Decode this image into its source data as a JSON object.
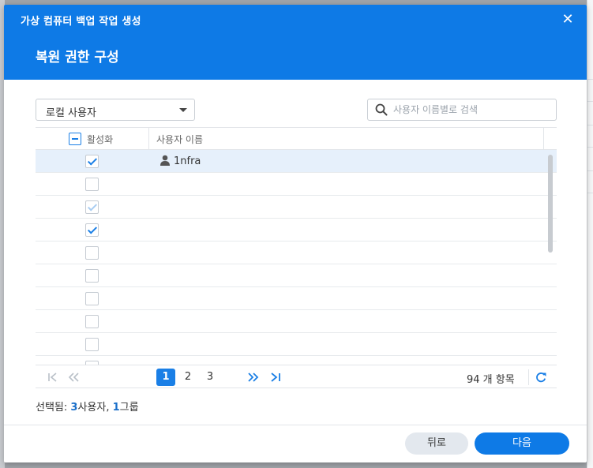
{
  "window": {
    "title": "가상 컴퓨터 백업 작업 생성",
    "close_glyph": "✕"
  },
  "step": {
    "title": "복원 권한 구성"
  },
  "filter": {
    "selected": "로컬 사용자"
  },
  "search": {
    "placeholder": "사용자 이름별로 검색",
    "value": ""
  },
  "grid": {
    "columns": {
      "enable": "활성화",
      "user_name": "사용자 이름"
    },
    "rows": [
      {
        "checked": true,
        "state": "on",
        "selected": true,
        "name": "1nfra"
      },
      {
        "checked": false,
        "state": "off",
        "selected": false,
        "name": ""
      },
      {
        "checked": true,
        "state": "dim",
        "selected": false,
        "name": ""
      },
      {
        "checked": true,
        "state": "on",
        "selected": false,
        "name": ""
      },
      {
        "checked": false,
        "state": "off",
        "selected": false,
        "name": ""
      },
      {
        "checked": false,
        "state": "off",
        "selected": false,
        "name": ""
      },
      {
        "checked": false,
        "state": "off",
        "selected": false,
        "name": ""
      },
      {
        "checked": false,
        "state": "off",
        "selected": false,
        "name": ""
      },
      {
        "checked": false,
        "state": "off",
        "selected": false,
        "name": ""
      },
      {
        "checked": false,
        "state": "off",
        "selected": false,
        "name": ""
      }
    ]
  },
  "pager": {
    "pages": [
      "1",
      "2",
      "3"
    ],
    "current": "1",
    "count_label": "94 개 항목"
  },
  "summary": {
    "prefix": "선택됨:",
    "users_count": "3",
    "users_label": "사용자,",
    "groups_count": "1",
    "groups_label": "그룹"
  },
  "buttons": {
    "back": "뒤로",
    "next": "다음"
  },
  "colors": {
    "accent": "#0e7ae6",
    "selected_row": "#e6f0fb"
  }
}
